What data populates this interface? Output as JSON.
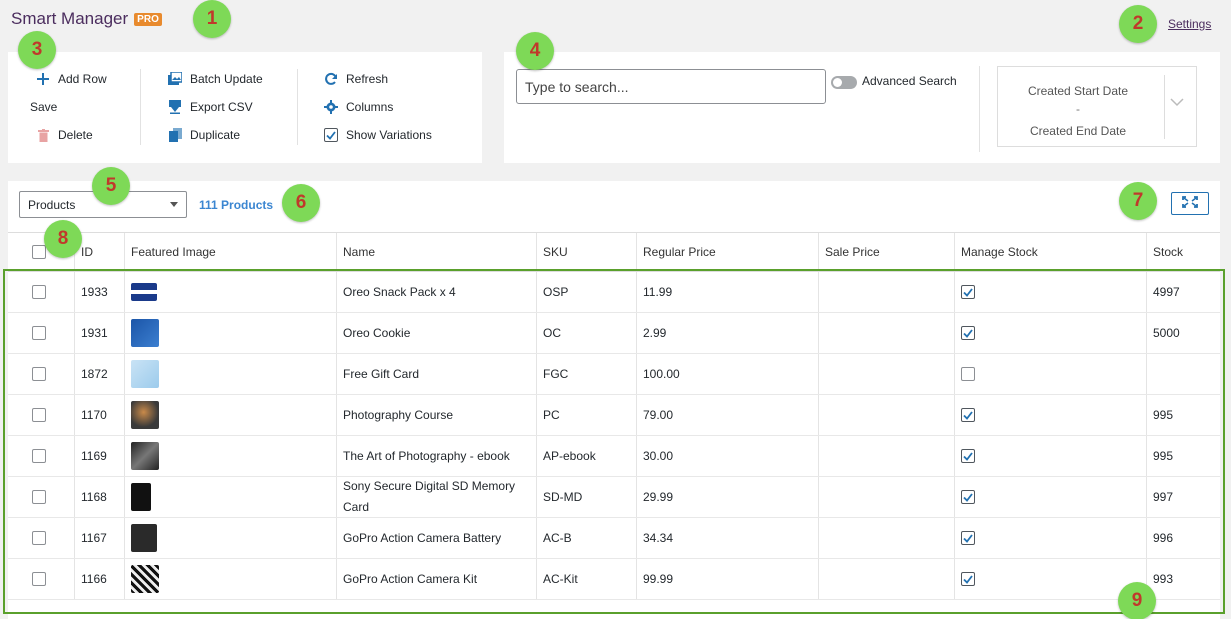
{
  "app": {
    "title": "Smart Manager",
    "badge": "PRO",
    "settings_label": "Settings"
  },
  "markers": [
    "1",
    "2",
    "3",
    "4",
    "5",
    "6",
    "7",
    "8",
    "9"
  ],
  "actions": {
    "add_row": "Add Row",
    "save": "Save",
    "delete": "Delete",
    "batch_update": "Batch Update",
    "export_csv": "Export CSV",
    "duplicate": "Duplicate",
    "refresh": "Refresh",
    "columns": "Columns",
    "show_variations": "Show Variations"
  },
  "search": {
    "placeholder": "Type to search...",
    "advanced_label": "Advanced Search",
    "date_start": "Created Start Date",
    "date_separator": "-",
    "date_end": "Created End Date"
  },
  "grid": {
    "dashboard_selected": "Products",
    "count_label": "111 Products",
    "columns": [
      "ID",
      "Featured Image",
      "Name",
      "SKU",
      "Regular Price",
      "Sale Price",
      "Manage Stock",
      "Stock"
    ],
    "rows": [
      {
        "id": "1933",
        "image": "oreo-pack-image",
        "name": "Oreo Snack Pack x 4",
        "sku": "OSP",
        "regular_price": "11.99",
        "sale_price": "",
        "manage_stock": true,
        "stock": "4997"
      },
      {
        "id": "1931",
        "image": "oreo-cookie-image",
        "name": "Oreo Cookie",
        "sku": "OC",
        "regular_price": "2.99",
        "sale_price": "",
        "manage_stock": true,
        "stock": "5000"
      },
      {
        "id": "1872",
        "image": "gift-card-image",
        "name": "Free Gift Card",
        "sku": "FGC",
        "regular_price": "100.00",
        "sale_price": "",
        "manage_stock": false,
        "stock": ""
      },
      {
        "id": "1170",
        "image": "photography-course-image",
        "name": "Photography Course",
        "sku": "PC",
        "regular_price": "79.00",
        "sale_price": "",
        "manage_stock": true,
        "stock": "995"
      },
      {
        "id": "1169",
        "image": "photography-ebook-image",
        "name": "The Art of Photography - ebook",
        "sku": "AP-ebook",
        "regular_price": "30.00",
        "sale_price": "",
        "manage_stock": true,
        "stock": "995"
      },
      {
        "id": "1168",
        "image": "sd-card-image",
        "name": "Sony Secure Digital SD Memory Card",
        "sku": "SD-MD",
        "regular_price": "29.99",
        "sale_price": "",
        "manage_stock": true,
        "stock": "997"
      },
      {
        "id": "1167",
        "image": "camera-battery-image",
        "name": "GoPro Action Camera Battery",
        "sku": "AC-B",
        "regular_price": "34.34",
        "sale_price": "",
        "manage_stock": true,
        "stock": "996"
      },
      {
        "id": "1166",
        "image": "camera-kit-image",
        "name": "GoPro Action Camera Kit",
        "sku": "AC-Kit",
        "regular_price": "99.99",
        "sale_price": "",
        "manage_stock": true,
        "stock": "993"
      }
    ]
  },
  "colors": {
    "accent": "#2271b1",
    "brand": "#4b2d5e",
    "badge": "#e88a2d",
    "count": "#3b86d1",
    "marker": "#7ed957",
    "highlight": "#5aa02c"
  }
}
